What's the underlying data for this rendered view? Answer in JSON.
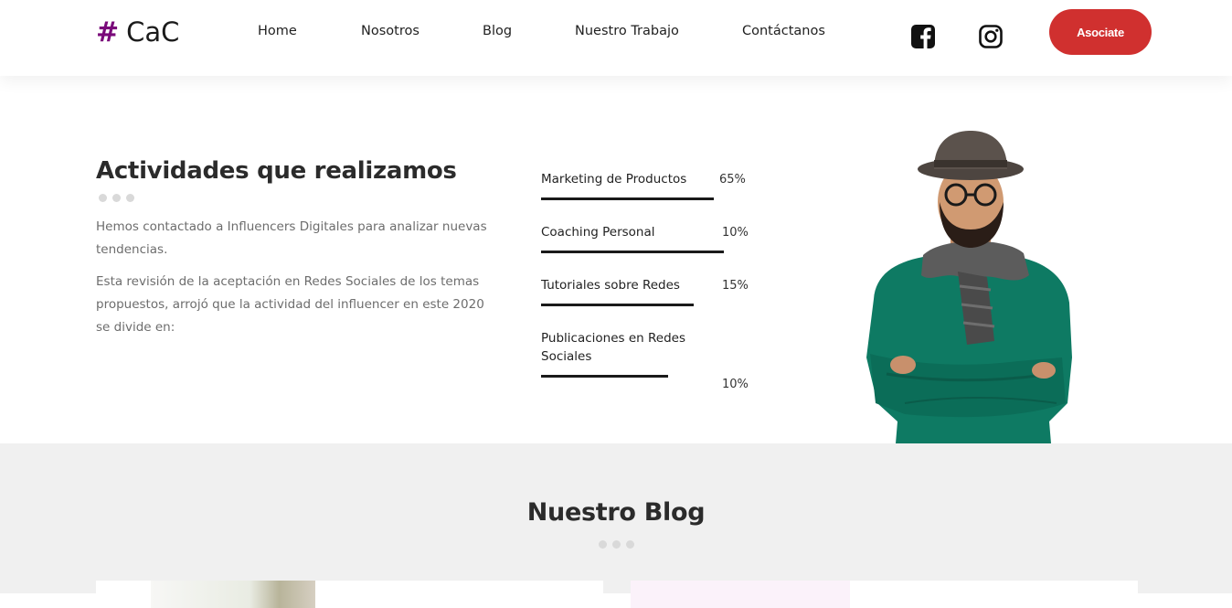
{
  "nav": {
    "logo_hash": "#",
    "logo_text": "CaC",
    "links": [
      "Home",
      "Nosotros",
      "Blog",
      "Nuestro Trabajo",
      "Contáctanos"
    ],
    "social_icons": [
      "facebook-icon",
      "instagram-icon"
    ],
    "cta_label": "Asociate",
    "cta_color": "#d0302f",
    "logo_color": "#7a0a7a"
  },
  "activities": {
    "title": "Actividades que realizamos",
    "paragraph1": "Hemos contactado a Influencers Digitales para analizar nuevas tendencias.",
    "paragraph2": "Esta revisión de la aceptación en Redes Sociales de los temas propuestos, arrojó que la actividad del influencer en este 2020 se divide en:",
    "skills": [
      {
        "label": "Marketing de Productos",
        "percent": "65%"
      },
      {
        "label": "Coaching Personal",
        "percent": "10%"
      },
      {
        "label": "Tutoriales sobre Redes",
        "percent": "15%"
      },
      {
        "label": "Publicaciones en Redes Sociales",
        "percent": "10%"
      }
    ]
  },
  "blog": {
    "title": "Nuestro Blog"
  }
}
